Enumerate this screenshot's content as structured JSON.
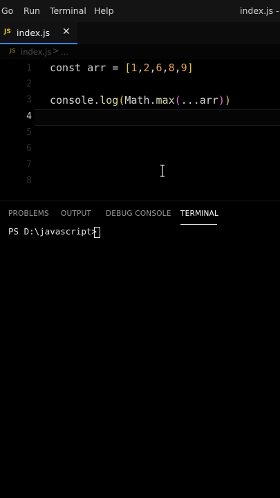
{
  "menubar": {
    "items": [
      "Go",
      "Run",
      "Terminal",
      "Help"
    ],
    "window_title": "index.js - ja"
  },
  "tab": {
    "icon": "JS",
    "filename": "index.js",
    "close_glyph": "✕"
  },
  "breadcrumb": {
    "icon": "JS",
    "file": "index.js",
    "separator": ">",
    "ellipsis": "..."
  },
  "editor": {
    "line_numbers": [
      "1",
      "2",
      "3",
      "4",
      "5",
      "6",
      "7",
      "8"
    ],
    "active_line": "4",
    "line1": {
      "keyword": "const",
      "name": "arr",
      "op": "=",
      "open": "[",
      "values": [
        "1",
        "2",
        "6",
        "8",
        "9"
      ],
      "close": "]"
    },
    "line3": {
      "obj": "console",
      "fn": "log",
      "math": "Math",
      "max": "max",
      "spread": "...arr"
    }
  },
  "panel": {
    "tabs": [
      "PROBLEMS",
      "OUTPUT",
      "DEBUG CONSOLE",
      "TERMINAL"
    ],
    "active_tab": "TERMINAL"
  },
  "terminal": {
    "prompt": "PS D:\\javascript>"
  },
  "colors": {
    "accent": "#3a86ff",
    "js_icon": "#e3c13a",
    "number": "#e8a04c",
    "bracket": "#e7c84a",
    "paren": "#da70d6"
  }
}
